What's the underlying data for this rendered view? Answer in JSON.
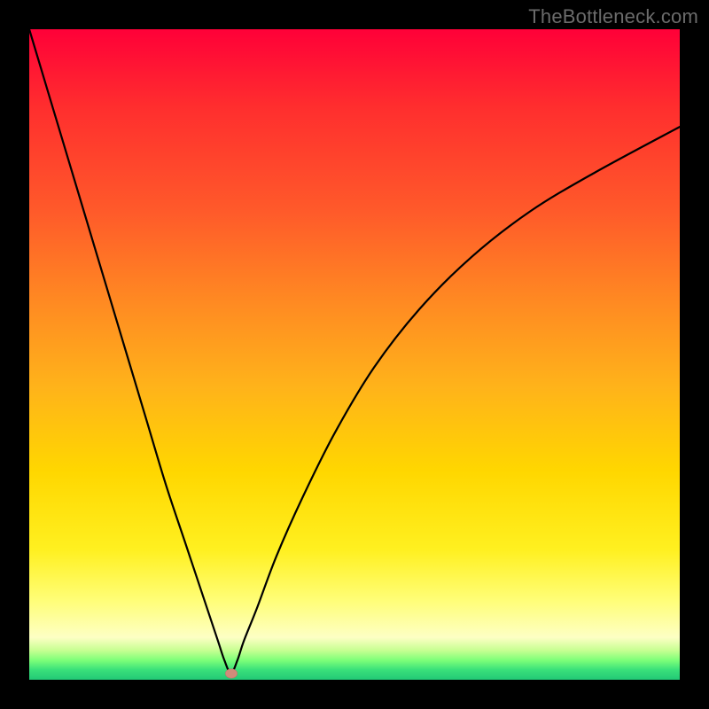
{
  "watermark": "TheBottleneck.com",
  "chart_data": {
    "type": "line",
    "title": "",
    "xlabel": "",
    "ylabel": "",
    "xlim": [
      0,
      100
    ],
    "ylim": [
      0,
      100
    ],
    "grid": false,
    "legend": false,
    "marker": {
      "x": 31,
      "y": 1
    },
    "series": [
      {
        "name": "curve",
        "x": [
          0,
          3,
          6,
          9,
          12,
          15,
          18,
          21,
          24,
          27,
          29,
          30,
          31,
          32,
          33,
          35,
          38,
          42,
          47,
          53,
          60,
          68,
          77,
          87,
          100
        ],
        "values": [
          100,
          90,
          80,
          70,
          60,
          50,
          40,
          30,
          21,
          12,
          6,
          3,
          1,
          3,
          6,
          11,
          19,
          28,
          38,
          48,
          57,
          65,
          72,
          78,
          85
        ]
      }
    ],
    "background_gradient": {
      "stops": [
        {
          "pos": 0.0,
          "color": "#ff0038"
        },
        {
          "pos": 0.12,
          "color": "#ff2e2e"
        },
        {
          "pos": 0.28,
          "color": "#ff5a2a"
        },
        {
          "pos": 0.42,
          "color": "#ff8a22"
        },
        {
          "pos": 0.55,
          "color": "#ffb31a"
        },
        {
          "pos": 0.68,
          "color": "#ffd700"
        },
        {
          "pos": 0.8,
          "color": "#fff020"
        },
        {
          "pos": 0.88,
          "color": "#fffe7a"
        },
        {
          "pos": 0.935,
          "color": "#fdffc4"
        },
        {
          "pos": 0.955,
          "color": "#c6ff91"
        },
        {
          "pos": 0.97,
          "color": "#7dff79"
        },
        {
          "pos": 0.985,
          "color": "#39e07a"
        },
        {
          "pos": 1.0,
          "color": "#22c876"
        }
      ]
    }
  }
}
